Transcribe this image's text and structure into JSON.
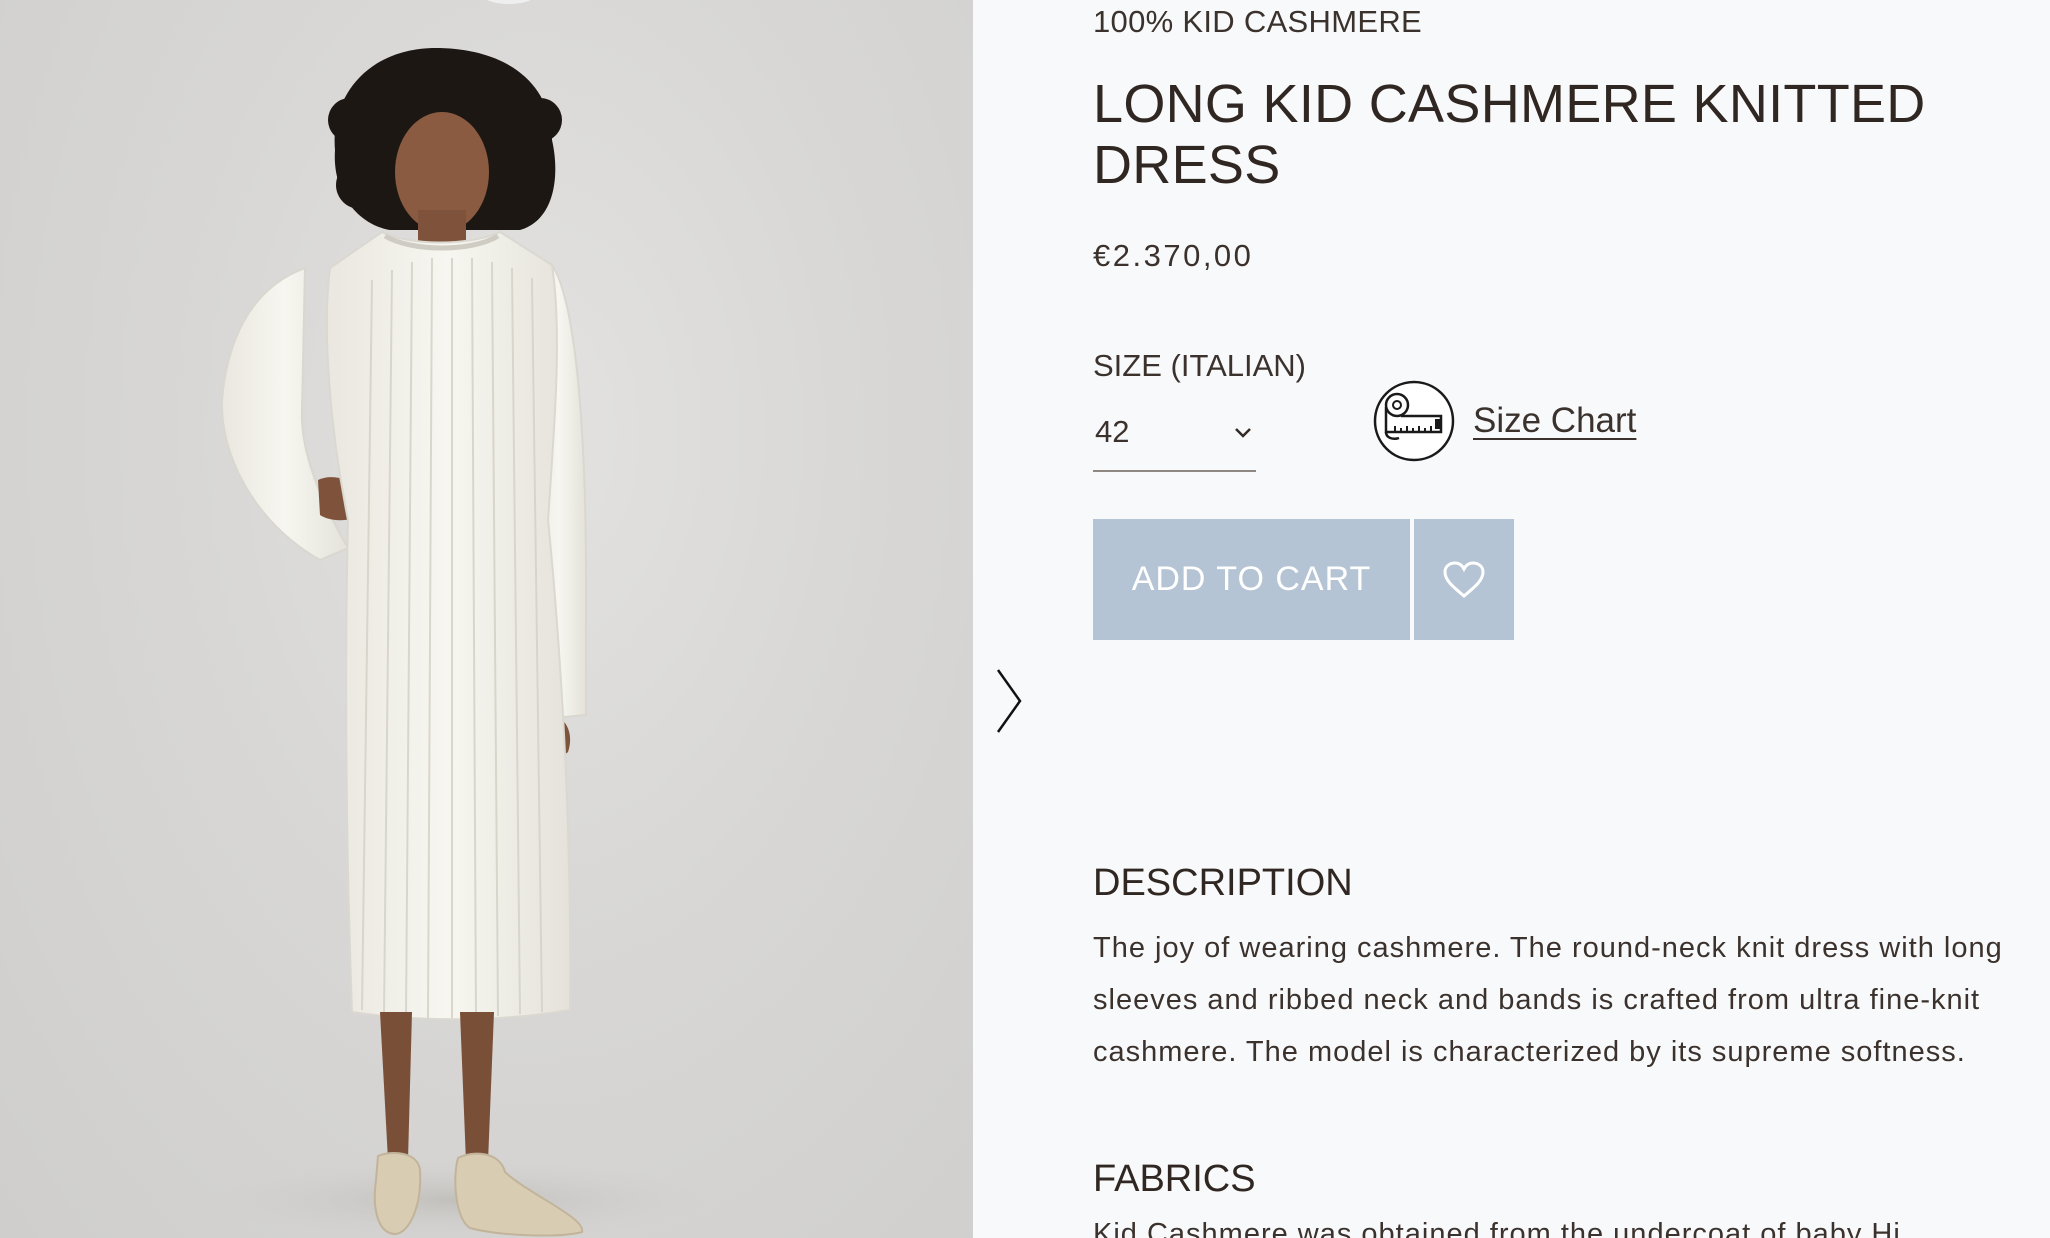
{
  "product": {
    "material_tag": "100% KID CASHMERE",
    "title": "LONG KID CASHMERE KNITTED DRESS",
    "price": "€2.370,00"
  },
  "size": {
    "label": "SIZE (ITALIAN)",
    "selected": "42",
    "chart_link": "Size Chart"
  },
  "actions": {
    "add_to_cart": "ADD TO CART",
    "wishlist_icon": "heart-icon"
  },
  "description": {
    "heading": "DESCRIPTION",
    "text": "The joy of wearing cashmere. The round-neck knit dress with long sleeves and ribbed neck and bands is crafted from ultra fine-knit cashmere. The model is characterized by its supreme softness."
  },
  "fabrics": {
    "heading": "FABRICS",
    "text_partial": "Kid Cashmere was obtained from the undercoat of baby Hi..."
  },
  "gallery": {
    "next_icon": "chevron-right-icon"
  },
  "colors": {
    "button_bg": "#b5c4d4",
    "text": "#332a25",
    "page_bg": "#f8f9fb"
  }
}
